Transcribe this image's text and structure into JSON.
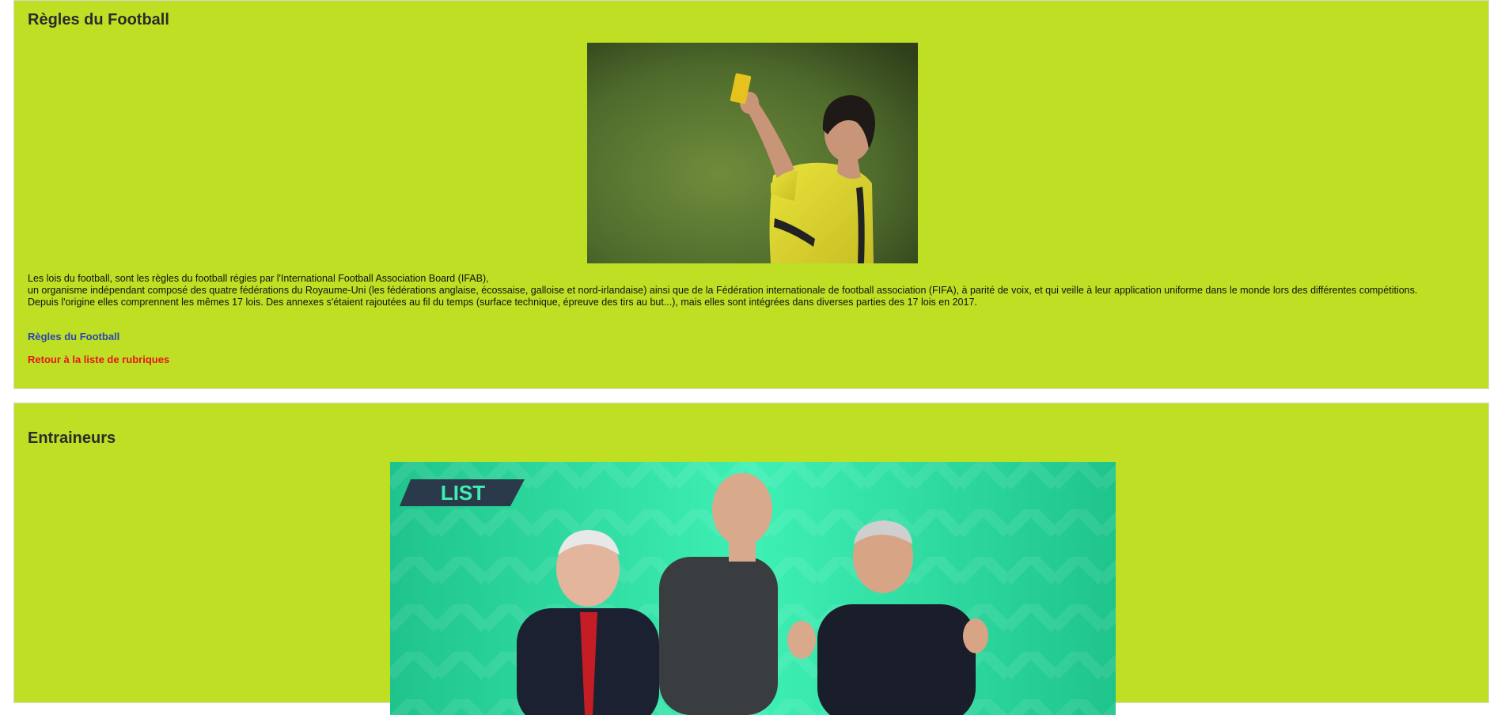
{
  "rules_section": {
    "title": "Règles du Football",
    "paragraphs": [
      "Les lois du football, sont les règles du football régies par l'International Football Association Board (IFAB),",
      "un organisme indépendant composé des quatre fédérations du Royaume-Uni (les fédérations anglaise, écossaise, galloise et nord-irlandaise) ainsi que de la Fédération internationale de football association (FIFA), à parité de voix, et qui veille à leur application uniforme dans le monde lors des différentes compétitions.",
      "Depuis l'origine elles comprennent les mêmes 17 lois. Des annexes s'étaient rajoutées au fil du temps (surface technique, épreuve des tirs au but...), mais elles sont intégrées dans diverses parties des 17 lois en 2017."
    ],
    "link_label": "Règles du Football",
    "back_label": "Retour à la liste de rubriques"
  },
  "coaches_section": {
    "title": "Entraineurs",
    "image_badge": "LIST"
  },
  "colors": {
    "section_bg": "#bedf24",
    "link_blue": "#2b45b3",
    "link_red": "#e8141c",
    "card_yellow": "#e6c21e",
    "banner_teal": "#2ed69e"
  }
}
